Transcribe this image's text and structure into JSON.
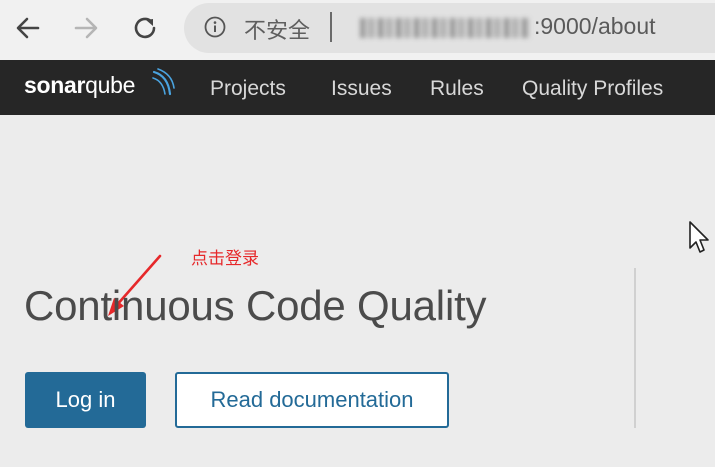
{
  "browser": {
    "security_label": "不安全",
    "url_visible": ":9000/about",
    "icons": [
      "back-arrow-icon",
      "forward-arrow-icon",
      "reload-icon",
      "info-icon"
    ]
  },
  "nav": {
    "logo_bold": "sonar",
    "logo_light": "qube",
    "items": [
      {
        "label": "Projects"
      },
      {
        "label": "Issues"
      },
      {
        "label": "Rules"
      },
      {
        "label": "Quality Profiles"
      }
    ]
  },
  "main": {
    "annotation": "点击登录",
    "title": "Continuous Code Quality",
    "login_label": "Log in",
    "docs_label": "Read documentation"
  },
  "colors": {
    "nav_bg": "#262626",
    "accent": "#236a97",
    "annotation": "#e6282a",
    "page_bg": "#ececec"
  }
}
